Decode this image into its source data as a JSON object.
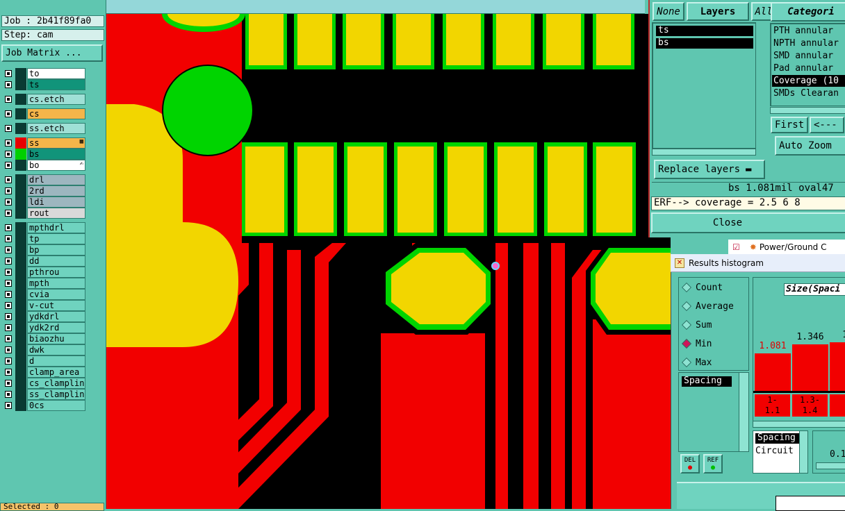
{
  "left_panel": {
    "job": "Job : 2b41f89fa0",
    "step": "Step: cam",
    "job_matrix_button": "Job Matrix ...",
    "layers": [
      {
        "name": "to",
        "bg": "#ffffff",
        "swatch": "#0a3b33"
      },
      {
        "name": "ts",
        "bg": "#11947a",
        "swatch": "#0a3b33"
      },
      {
        "name": "cs.etch",
        "bg": "#9fe0d6",
        "swatch": "#0a3b33"
      },
      {
        "name": "cs",
        "bg": "#f5b54a",
        "swatch": "#0a3b33"
      },
      {
        "name": "ss.etch",
        "bg": "#9fe0d6",
        "swatch": "#0a3b33"
      },
      {
        "name": "ss",
        "bg": "#f5b54a",
        "swatch": "#e80000",
        "mark": "▦"
      },
      {
        "name": "bs",
        "bg": "#11947a",
        "swatch": "#00d000"
      },
      {
        "name": "bo",
        "bg": "#ffffff",
        "swatch": "#0a3b33",
        "mark": "✍"
      },
      {
        "name": "drl",
        "bg": "#9db6bf",
        "swatch": "#0a3b33"
      },
      {
        "name": "2rd",
        "bg": "#9db6bf",
        "swatch": "#0a3b33"
      },
      {
        "name": "ldi",
        "bg": "#9db6bf",
        "swatch": "#0a3b33"
      },
      {
        "name": "rout",
        "bg": "#d9d9d9",
        "swatch": "#0a3b33"
      },
      {
        "name": "mpthdrl",
        "bg": "#6fd3bf",
        "swatch": "#0a3b33"
      },
      {
        "name": "tp",
        "bg": "#6fd3bf",
        "swatch": "#0a3b33"
      },
      {
        "name": "bp",
        "bg": "#6fd3bf",
        "swatch": "#0a3b33"
      },
      {
        "name": "dd",
        "bg": "#6fd3bf",
        "swatch": "#0a3b33"
      },
      {
        "name": "pthrou",
        "bg": "#6fd3bf",
        "swatch": "#0a3b33"
      },
      {
        "name": "mpth",
        "bg": "#6fd3bf",
        "swatch": "#0a3b33"
      },
      {
        "name": "cvia",
        "bg": "#6fd3bf",
        "swatch": "#0a3b33"
      },
      {
        "name": "v-cut",
        "bg": "#6fd3bf",
        "swatch": "#0a3b33"
      },
      {
        "name": "ydkdrl",
        "bg": "#6fd3bf",
        "swatch": "#0a3b33"
      },
      {
        "name": "ydk2rd",
        "bg": "#6fd3bf",
        "swatch": "#0a3b33"
      },
      {
        "name": "biaozhu",
        "bg": "#6fd3bf",
        "swatch": "#0a3b33"
      },
      {
        "name": "dwk",
        "bg": "#6fd3bf",
        "swatch": "#0a3b33"
      },
      {
        "name": "d",
        "bg": "#6fd3bf",
        "swatch": "#0a3b33"
      },
      {
        "name": "clamp_area",
        "bg": "#6fd3bf",
        "swatch": "#0a3b33"
      },
      {
        "name": "cs_clampline",
        "bg": "#6fd3bf",
        "swatch": "#0a3b33"
      },
      {
        "name": "ss_clampline",
        "bg": "#6fd3bf",
        "swatch": "#0a3b33"
      },
      {
        "name": "0cs",
        "bg": "#6fd3bf",
        "swatch": "#0a3b33"
      }
    ],
    "selected": "Selected : 0"
  },
  "layers_dialog": {
    "none_label": "None",
    "layers_label": "Layers",
    "all_label": "All",
    "selected_layers": [
      "ts",
      "bs"
    ],
    "replace_layers_button": "Replace layers",
    "category_header": "Categori",
    "categories": [
      "PTH annular",
      "NPTH annular",
      "SMD annular",
      "Pad annular",
      "Coverage (10",
      "SMDs Clearan"
    ],
    "first_button": "First",
    "prev_button": "<---",
    "auto_zoom_button": "Auto Zoom",
    "status_line": "bs 1.081mil  oval47",
    "erf_line": "ERF--> coverage = 2.5 6 8",
    "close_button": "Close",
    "behind_item": "Power/Ground C"
  },
  "histogram": {
    "window_title": "Results histogram",
    "modes": [
      "Count",
      "Average",
      "Sum",
      "Min",
      "Max"
    ],
    "selected_mode": "Min",
    "heading": "Size(Spaci",
    "type_list": [
      "Spacing"
    ],
    "del_label": "DEL",
    "ref_label": "REF",
    "bottom_list": [
      "Spacing",
      "Circuit"
    ],
    "value_label": "0.1",
    "chart_data": {
      "type": "bar",
      "categories": [
        "1-1.1",
        "1.3-1.4",
        "1"
      ],
      "values": [
        1.081,
        1.346,
        1.4
      ],
      "value_labels": [
        "1.081",
        "1.346",
        "1."
      ]
    }
  },
  "colors": {
    "panel": "#5fc6b0",
    "copper": "#f20000",
    "pad": "#f2d600",
    "mask": "#00d400",
    "gap": "#000000"
  }
}
